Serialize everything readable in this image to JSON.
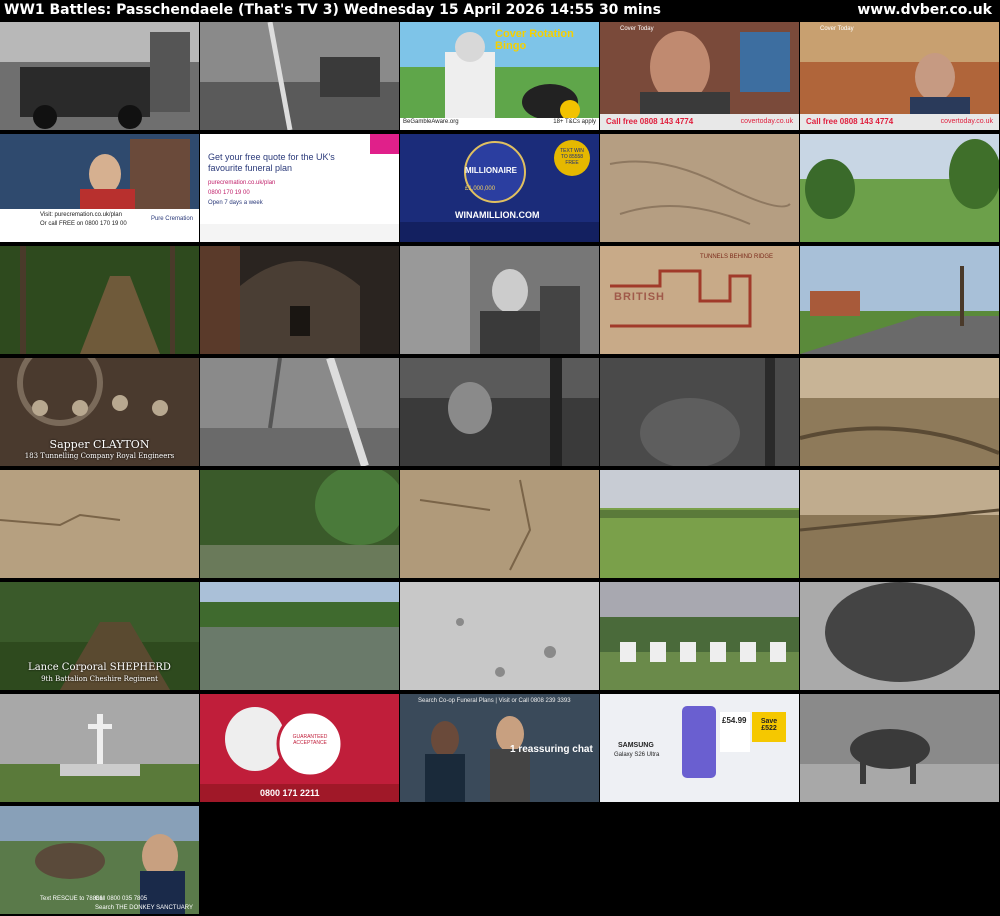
{
  "header": {
    "title": "WW1 Battles: Passchendaele (That's TV 3)    Wednesday 15 April 2026  14:55  30 mins",
    "site": "www.dvber.co.uk"
  },
  "captions": {
    "sapper_name": "Sapper CLAYTON",
    "sapper_unit": "183 Tunnelling Company Royal Engineers",
    "lance_name": "Lance Corporal SHEPHERD",
    "lance_unit": "9th Battalion Cheshire Regiment",
    "trench_map_title": "TUNNELS BEHIND RIDGE",
    "trench_map_label": "BRITISH"
  },
  "ads": {
    "bingo_title": "Cover Rotation Bingo",
    "begamble": "BeGambleAware.org",
    "begamble_age": "18+ T&Cs apply",
    "covertoday_brand": "Cover Today",
    "covertoday_phone": "Call free 0808 143 4774",
    "covertoday_site": "covertoday.co.uk",
    "purecremation_visit": "Visit: purecremation.co.uk/plan",
    "purecremation_call": "Or call FREE on 0800 170 19 00",
    "purecremation_brand": "Pure Cremation",
    "funeral_plan_headline": "Get your free quote for the UK's favourite funeral plan",
    "funeral_plan_url": "purecremation.co.uk/plan",
    "funeral_plan_phone": "0800 170 19 00",
    "funeral_plan_hours": "Open 7 days a week",
    "millionaire_title": "MILLIONAIRE",
    "millionaire_site": "WINAMILLION.COM",
    "millionaire_prize": "£1,000,000",
    "millionaire_text": "TEXT WIN TO 85558 FREE",
    "acceptance_badge": "GUARANTEED ACCEPTANCE",
    "acceptance_phone": "0800 171 2211",
    "coop_search": "Search Co-op Funeral Plans | Visit or Call 0808 239 3393",
    "coop_chat": "1 reassuring chat",
    "samsung_brand": "SAMSUNG",
    "samsung_model": "Galaxy S26 Ultra",
    "samsung_price": "£54.99",
    "samsung_save": "Save £522",
    "donkey_rescue": "Text RESCUE to 78866",
    "donkey_call": "Call 0800 035 7805",
    "donkey_search": "Search THE DONKEY SANCTUARY"
  }
}
